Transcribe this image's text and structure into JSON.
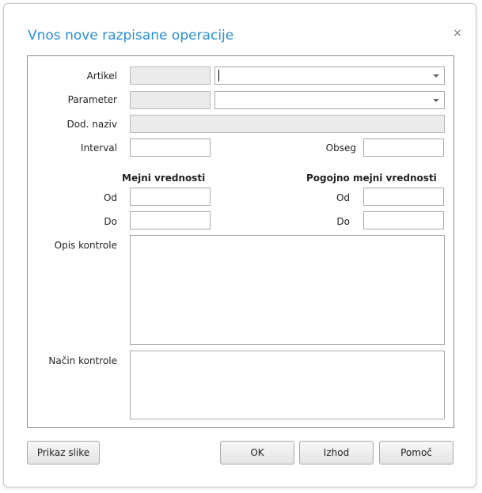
{
  "dialog": {
    "title": "Vnos nove razpisane operacije",
    "close_symbol": "×"
  },
  "form": {
    "artikel_label": "Artikel",
    "parameter_label": "Parameter",
    "dod_naziv_label": "Dod. naziv",
    "interval_label": "Interval",
    "obseg_label": "Obseg",
    "mejni_header": "Mejni vrednosti",
    "pogojno_header": "Pogojno mejni vrednosti",
    "od_label": "Od",
    "do_label": "Do",
    "opis_label": "Opis kontrole",
    "nacin_label": "Način kontrole"
  },
  "buttons": {
    "prikaz_slike": "Prikaz slike",
    "ok": "OK",
    "izhod": "Izhod",
    "pomoc": "Pomoč"
  },
  "icons": {
    "close": "close-icon",
    "dropdown": "chevron-down-icon"
  }
}
